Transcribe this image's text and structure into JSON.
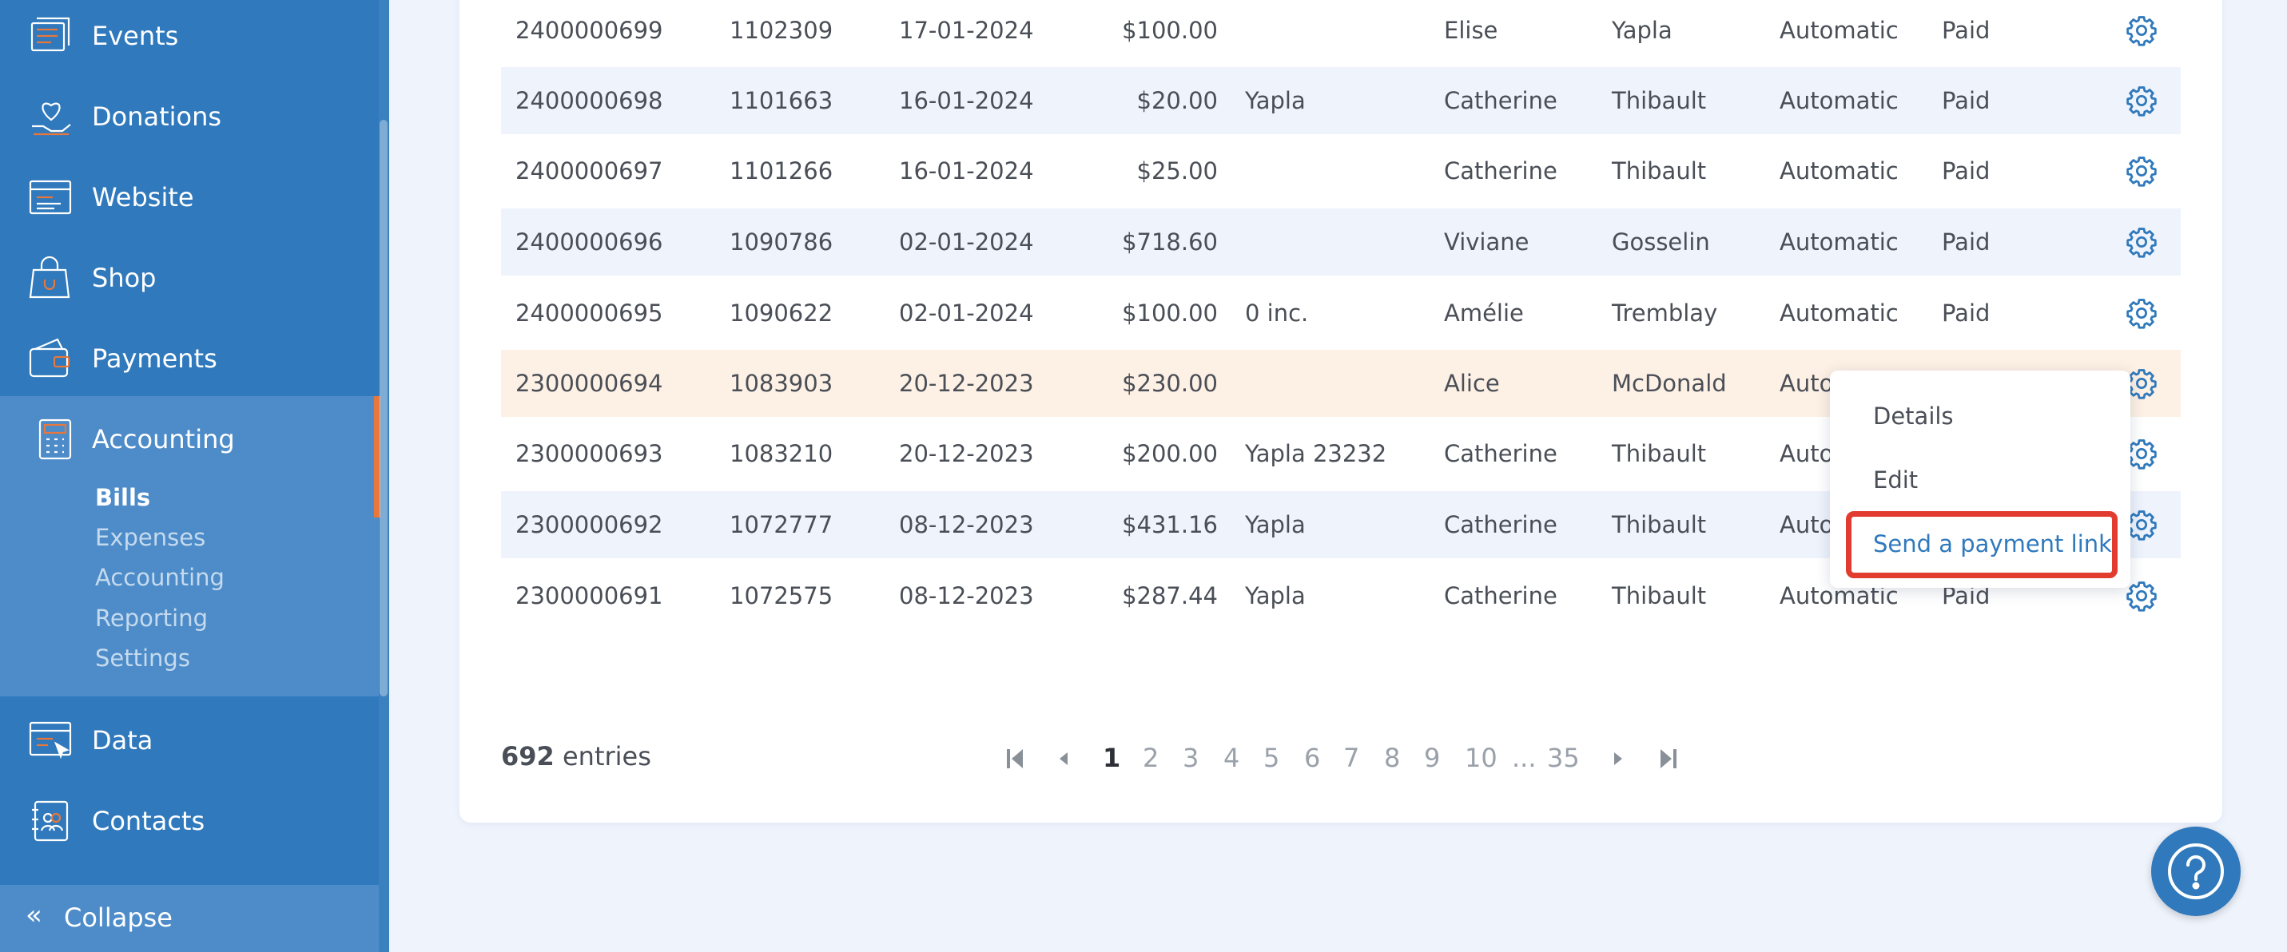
{
  "sidebar": {
    "items": [
      {
        "label": "Events",
        "icon": "ticket-icon"
      },
      {
        "label": "Donations",
        "icon": "heart-hand-icon"
      },
      {
        "label": "Website",
        "icon": "browser-icon"
      },
      {
        "label": "Shop",
        "icon": "shopping-bag-icon"
      },
      {
        "label": "Payments",
        "icon": "wallet-icon"
      },
      {
        "label": "Accounting",
        "icon": "calculator-icon"
      },
      {
        "label": "Data",
        "icon": "data-cursor-icon"
      },
      {
        "label": "Contacts",
        "icon": "contacts-book-icon"
      }
    ],
    "accounting_sub": [
      "Bills",
      "Expenses",
      "Accounting",
      "Reporting",
      "Settings"
    ],
    "collapse_label": "Collapse",
    "colors": {
      "sidebar": "#2f79bc",
      "active_block": "#4d8cc8",
      "accent": "#e8773b"
    }
  },
  "table": {
    "rows": [
      {
        "bill": "2400000699",
        "ref": "1102309",
        "date": "17-01-2024",
        "amount": "$100.00",
        "note": "",
        "first": "Elise",
        "last": "Yapla",
        "type": "Automatic",
        "status": "Paid"
      },
      {
        "bill": "2400000698",
        "ref": "1101663",
        "date": "16-01-2024",
        "amount": "$20.00",
        "note": "Yapla",
        "first": "Catherine",
        "last": "Thibault",
        "type": "Automatic",
        "status": "Paid"
      },
      {
        "bill": "2400000697",
        "ref": "1101266",
        "date": "16-01-2024",
        "amount": "$25.00",
        "note": "",
        "first": "Catherine",
        "last": "Thibault",
        "type": "Automatic",
        "status": "Paid"
      },
      {
        "bill": "2400000696",
        "ref": "1090786",
        "date": "02-01-2024",
        "amount": "$718.60",
        "note": "",
        "first": "Viviane",
        "last": "Gosselin",
        "type": "Automatic",
        "status": "Paid"
      },
      {
        "bill": "2400000695",
        "ref": "1090622",
        "date": "02-01-2024",
        "amount": "$100.00",
        "note": "0 inc.",
        "first": "Amélie",
        "last": "Tremblay",
        "type": "Automatic",
        "status": "Paid"
      },
      {
        "bill": "2300000694",
        "ref": "1083903",
        "date": "20-12-2023",
        "amount": "$230.00",
        "note": "",
        "first": "Alice",
        "last": "McDonald",
        "type": "Auto",
        "status": ""
      },
      {
        "bill": "2300000693",
        "ref": "1083210",
        "date": "20-12-2023",
        "amount": "$200.00",
        "note": "Yapla 23232",
        "first": "Catherine",
        "last": "Thibault",
        "type": "Auto",
        "status": ""
      },
      {
        "bill": "2300000692",
        "ref": "1072777",
        "date": "08-12-2023",
        "amount": "$431.16",
        "note": "Yapla",
        "first": "Catherine",
        "last": "Thibault",
        "type": "Auto",
        "status": ""
      },
      {
        "bill": "2300000691",
        "ref": "1072575",
        "date": "08-12-2023",
        "amount": "$287.44",
        "note": "Yapla",
        "first": "Catherine",
        "last": "Thibault",
        "type": "Automatic",
        "status": "Paid"
      }
    ],
    "colors": {
      "alt_row": "#eef3fc",
      "highlight_row": "#fdf0e4"
    }
  },
  "footer": {
    "entries_count": "692",
    "entries_label": "entries",
    "pages": [
      "1",
      "2",
      "3",
      "4",
      "5",
      "6",
      "7",
      "8",
      "9",
      "10"
    ],
    "ellipsis": "...",
    "last_page": "35",
    "current_page": "1"
  },
  "dropdown": {
    "details": "Details",
    "edit": "Edit",
    "send_link": "Send a payment link",
    "highlight_color": "#e23b30"
  },
  "help": {
    "icon": "help-question-icon"
  }
}
